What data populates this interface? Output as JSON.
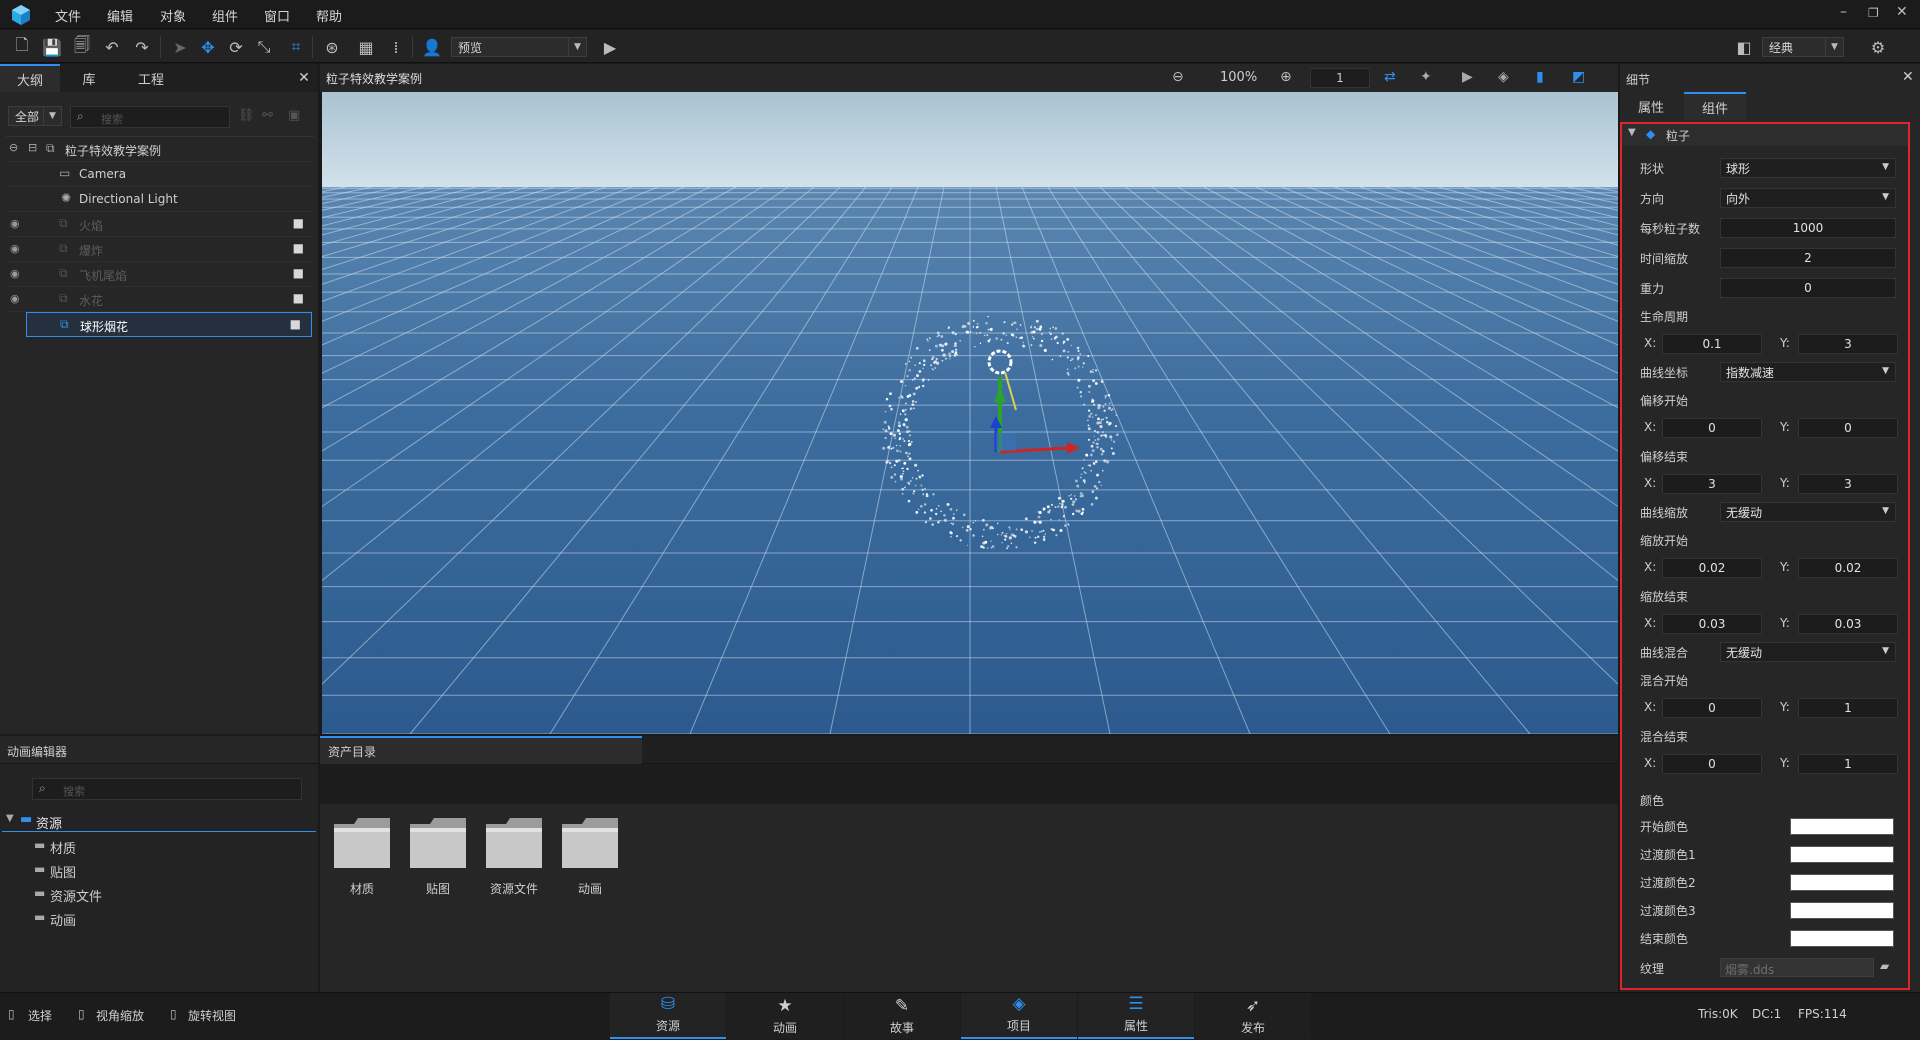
{
  "menubar": {
    "items": [
      "文件",
      "编辑",
      "对象",
      "组件",
      "窗口",
      "帮助"
    ]
  },
  "toolbar": {
    "mode_dropdown": "预览",
    "layout_dropdown": "经典"
  },
  "outline": {
    "tabs": [
      "大纲",
      "库",
      "工程"
    ],
    "filter": "全部",
    "search_placeholder": "搜索",
    "tree": [
      {
        "label": "粒子特效教学案例",
        "type": "root"
      },
      {
        "label": "Camera",
        "type": "camera"
      },
      {
        "label": "Directional Light",
        "type": "light"
      },
      {
        "label": "火焰",
        "type": "particle",
        "hidden": true
      },
      {
        "label": "爆炸",
        "type": "particle",
        "hidden": true
      },
      {
        "label": "飞机尾焰",
        "type": "particle",
        "hidden": true
      },
      {
        "label": "水花",
        "type": "particle",
        "hidden": true
      },
      {
        "label": "球形烟花",
        "type": "particle",
        "selected": true
      }
    ]
  },
  "viewport": {
    "title": "粒子特效教学案例",
    "zoom": "100%",
    "frame": "1"
  },
  "details": {
    "title": "细节",
    "tabs": [
      "属性",
      "组件"
    ],
    "section": "粒子",
    "shape_label": "形状",
    "shape_value": "球形",
    "direction_label": "方向",
    "direction_value": "向外",
    "rate_label": "每秒粒子数",
    "rate_value": "1000",
    "timescale_label": "时间缩放",
    "timescale_value": "2",
    "gravity_label": "重力",
    "gravity_value": "0",
    "life_label": "生命周期",
    "life_x": "0.1",
    "life_y": "3",
    "curve_coord_label": "曲线坐标",
    "curve_coord_value": "指数减速",
    "offset_start_label": "偏移开始",
    "offset_start_x": "0",
    "offset_start_y": "0",
    "offset_end_label": "偏移结束",
    "offset_end_x": "3",
    "offset_end_y": "3",
    "curve_scale_label": "曲线缩放",
    "curve_scale_value": "无缓动",
    "scale_start_label": "缩放开始",
    "scale_start_x": "0.02",
    "scale_start_y": "0.02",
    "scale_end_label": "缩放结束",
    "scale_end_x": "0.03",
    "scale_end_y": "0.03",
    "curve_blend_label": "曲线混合",
    "curve_blend_value": "无缓动",
    "blend_start_label": "混合开始",
    "blend_start_x": "0",
    "blend_start_y": "1",
    "blend_end_label": "混合结束",
    "blend_end_x": "0",
    "blend_end_y": "1",
    "color_label": "颜色",
    "color_start_label": "开始颜色",
    "color_t1_label": "过渡颜色1",
    "color_t2_label": "过渡颜色2",
    "color_t3_label": "过渡颜色3",
    "color_end_label": "结束颜色",
    "texture_label": "纹理",
    "texture_value": "烟雾.dds",
    "x": "X:",
    "y": "Y:"
  },
  "anim_editor": {
    "title": "动画编辑器",
    "search_placeholder": "搜索",
    "root": "资源",
    "children": [
      "材质",
      "贴图",
      "资源文件",
      "动画"
    ]
  },
  "assets": {
    "tab": "资产目录",
    "folders": [
      "材质",
      "贴图",
      "资源文件",
      "动画"
    ]
  },
  "statusbar": {
    "tools": [
      "选择",
      "视角缩放",
      "旋转视图"
    ],
    "tabs": [
      "资源",
      "动画",
      "故事",
      "项目",
      "属性",
      "发布"
    ],
    "tris": "Tris:0K",
    "dc": "DC:1",
    "fps": "FPS:114"
  },
  "colors": {
    "accent": "#2f8ef0",
    "highlight_border": "#e0242a"
  }
}
